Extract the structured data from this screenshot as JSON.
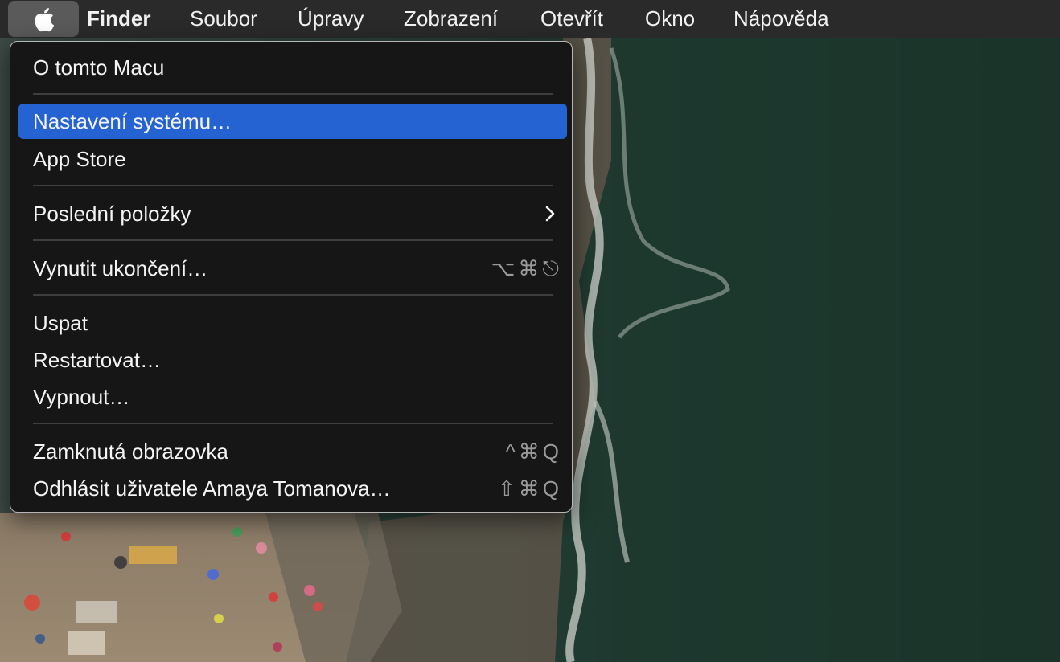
{
  "menubar": {
    "apple_icon": "apple-logo-icon",
    "items": [
      {
        "label": "Finder",
        "bold": true
      },
      {
        "label": "Soubor"
      },
      {
        "label": "Úpravy"
      },
      {
        "label": "Zobrazení"
      },
      {
        "label": "Otevřít"
      },
      {
        "label": "Okno"
      },
      {
        "label": "Nápověda"
      }
    ]
  },
  "apple_menu": {
    "items": [
      {
        "label": "O tomto Macu"
      },
      {
        "label": "Nastavení systému…",
        "highlighted": true
      },
      {
        "label": "App Store"
      },
      {
        "label": "Poslední položky",
        "submenu_icon": "chevron-right-icon"
      },
      {
        "label": "Vynutit ukončení…",
        "shortcut": [
          "⌥",
          "⌘",
          "⎋"
        ]
      },
      {
        "label": "Uspat"
      },
      {
        "label": "Restartovat…"
      },
      {
        "label": "Vypnout…"
      },
      {
        "label": "Zamknutá obrazovka",
        "shortcut": [
          "^",
          "⌘",
          "Q"
        ]
      },
      {
        "label": "Odhlásit uživatele Amaya Tomanova…",
        "shortcut": [
          "⇧",
          "⌘",
          "Q"
        ]
      }
    ]
  },
  "colors": {
    "highlight": "#2463d1",
    "menu_background": "#161616",
    "menubar_background": "#2a2a2a"
  }
}
